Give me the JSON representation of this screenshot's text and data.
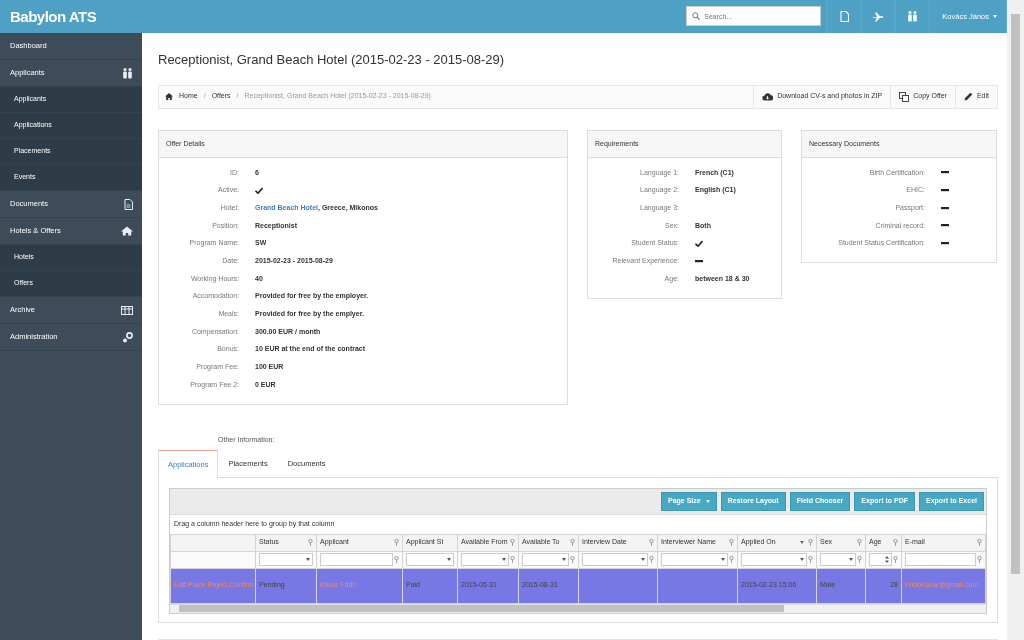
{
  "app": {
    "logo": "Babylon ATS",
    "search": {
      "placeholder": "Search..."
    },
    "user": "Kovács János"
  },
  "sidebar": {
    "items": [
      {
        "label": "Dashboard"
      },
      {
        "label": "Applicants",
        "expanded": true,
        "children": [
          {
            "label": "Applicants"
          },
          {
            "label": "Applications"
          },
          {
            "label": "Placements"
          },
          {
            "label": "Events"
          }
        ]
      },
      {
        "label": "Documents"
      },
      {
        "label": "Hotels & Offers",
        "expanded": true,
        "children": [
          {
            "label": "Hotels"
          },
          {
            "label": "Offers"
          }
        ]
      },
      {
        "label": "Archive"
      },
      {
        "label": "Administration"
      }
    ]
  },
  "page_title": "Receptionist, Grand Beach Hotel (2015-02-23 - 2015-08-29)",
  "breadcrumb": [
    {
      "label": "Home",
      "current": false
    },
    {
      "separator": "/",
      "label": "Offers",
      "current": false
    },
    {
      "separator": "/",
      "label": "Receptionist, Grand Beach Hotel (2015-02-23 - 2015-08-29)",
      "current": true
    }
  ],
  "actions": [
    "Download CV-s and photos in ZIP",
    "Copy Offer",
    "Edit"
  ],
  "panels": [
    {
      "title": "Offer Details",
      "rows": [
        {
          "label": "ID:",
          "kind": "text",
          "value": "6"
        },
        {
          "label": "Active:",
          "kind": "flag",
          "checked": true
        },
        {
          "label": "Hotel:",
          "kind": "link",
          "link": "Grand Beach Hotel",
          "value": ", Greece, Mikonos"
        },
        {
          "label": "Position:",
          "kind": "text",
          "value": "Receptionist"
        },
        {
          "label": "Program Name:",
          "kind": "text",
          "value": "SW"
        },
        {
          "label": "Date:",
          "kind": "text",
          "value": "2015-02-23 - 2015-08-29"
        },
        {
          "label": "Working Hours:",
          "kind": "text",
          "value": "40"
        },
        {
          "label": "Accomodation:",
          "kind": "text",
          "value": "Provided for free by the employer."
        },
        {
          "label": "Meals:",
          "kind": "text",
          "value": "Provided for free by the emplyer."
        },
        {
          "label": "Compensation:",
          "kind": "text",
          "value": "300.00 EUR / month"
        },
        {
          "label": "Bonus:",
          "kind": "text",
          "value": "10 EUR at the end of the contract"
        },
        {
          "label": "Program Fee:",
          "kind": "text",
          "value": "100 EUR"
        },
        {
          "label": "Program Fee 2:",
          "kind": "text",
          "value": "0 EUR"
        }
      ]
    },
    {
      "title": "Requirements",
      "rows": [
        {
          "label": "Language 1:",
          "kind": "text",
          "value": "French (C1)"
        },
        {
          "label": "Language 2:",
          "kind": "text",
          "value": "English (C1)"
        },
        {
          "label": "Language 3:",
          "kind": "text"
        },
        {
          "label": "Sex:",
          "kind": "text",
          "value": "Both"
        },
        {
          "label": "Student Status:",
          "kind": "flag",
          "checked": true
        },
        {
          "label": "Relevant Experience:",
          "kind": "flag",
          "checked": false
        },
        {
          "label": "Age:",
          "kind": "text",
          "value": "between 18 & 30"
        }
      ]
    },
    {
      "title": "Necessary Documents",
      "rows": [
        {
          "label": "Birth Certification:",
          "kind": "flag",
          "checked": false
        },
        {
          "label": "EHIC:",
          "kind": "flag",
          "checked": false
        },
        {
          "label": "Passport:",
          "kind": "flag",
          "checked": false
        },
        {
          "label": "Criminal record:",
          "kind": "flag",
          "checked": false
        },
        {
          "label": "Student Status Certification:",
          "kind": "flag",
          "checked": false
        }
      ]
    }
  ],
  "other_information": "Other Information:",
  "tabs": [
    {
      "label": "Applications",
      "selected": true
    },
    {
      "label": "Placements",
      "selected": false
    },
    {
      "label": "Documents",
      "selected": false
    }
  ],
  "grid": {
    "toolbar": [
      {
        "label": "Page Size",
        "kind": "dropdown"
      },
      {
        "label": "Restore Layout",
        "kind": "plain"
      },
      {
        "label": "Field Chooser",
        "kind": "plain"
      },
      {
        "label": "Export to PDF",
        "kind": "plain"
      },
      {
        "label": "Export to Excel",
        "kind": "plain"
      }
    ],
    "group_hint": "Drag a column header here to group by that column",
    "columns": [
      {},
      {
        "label": "Status",
        "sorted": false
      },
      {
        "label": "Applicant",
        "sorted": false
      },
      {
        "label": "Applicant St",
        "sorted": false
      },
      {
        "label": "Available From",
        "sorted": false
      },
      {
        "label": "Available To",
        "sorted": false
      },
      {
        "label": "Interview Date",
        "sorted": false
      },
      {
        "label": "Interviewer Name",
        "sorted": false
      },
      {
        "label": "Applied On",
        "sorted": true
      },
      {
        "label": "Sex",
        "sorted": false
      },
      {
        "label": "Age",
        "sorted": false
      },
      {
        "label": "E-mail",
        "sorted": false
      }
    ],
    "filters": [
      {
        "kind": "none"
      },
      {
        "kind": "dropdown"
      },
      {
        "kind": "text"
      },
      {
        "kind": "dropdown"
      },
      {
        "kind": "dropdown"
      },
      {
        "kind": "dropdown"
      },
      {
        "kind": "dropdown"
      },
      {
        "kind": "dropdown"
      },
      {
        "kind": "dropdown"
      },
      {
        "kind": "dropdown"
      },
      {
        "kind": "spin"
      },
      {
        "kind": "text"
      }
    ],
    "rows": [
      {
        "selected": true,
        "cells": [
          {
            "kind": "actions",
            "links": [
              "Edit",
              "Place",
              "Reject",
              "Confirm"
            ]
          },
          {
            "kind": "text",
            "value": "Pending"
          },
          {
            "kind": "link",
            "value": "Kavar Frido"
          },
          {
            "kind": "text",
            "value": "Paid"
          },
          {
            "kind": "text",
            "value": "2015-05-31"
          },
          {
            "kind": "text",
            "value": "2015-08-31"
          },
          {
            "kind": "text"
          },
          {
            "kind": "text"
          },
          {
            "kind": "text",
            "value": "2015-02-23 15:06"
          },
          {
            "kind": "text",
            "value": "Male"
          },
          {
            "kind": "number",
            "value": "28"
          },
          {
            "kind": "link",
            "value": "FridoKavar@gmail.com"
          }
        ]
      }
    ]
  }
}
